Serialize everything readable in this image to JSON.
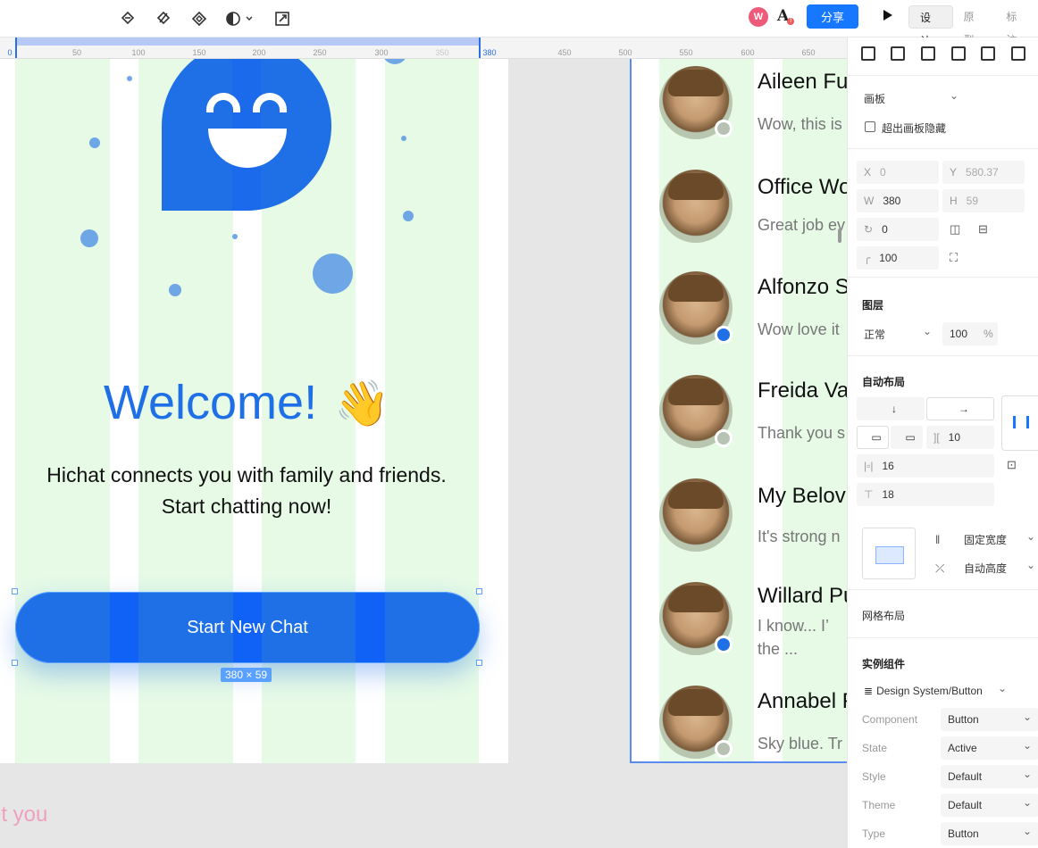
{
  "toolbar": {
    "icons": [
      "component-link-icon",
      "detach-icon",
      "instance-diamond-icon",
      "contrast-icon",
      "export-icon"
    ],
    "avatar_letter": "W",
    "share_label": "分享",
    "tabs": [
      "设计",
      "原型",
      "标注"
    ],
    "active_tab": "设计"
  },
  "ruler": {
    "ticks": [
      "0",
      "50",
      "100",
      "150",
      "200",
      "250",
      "300",
      "350",
      "380",
      "450",
      "500",
      "550",
      "600",
      "650"
    ]
  },
  "left_frame": {
    "welcome": "Welcome!",
    "wave_emoji": "👋",
    "subtitle_line1": "Hichat connects you with family and friends.",
    "subtitle_line2": "Start chatting now!",
    "button_label": "Start New Chat",
    "size_label": "380 × 59"
  },
  "ghost_text": {
    "line1": "et you",
    "line2": "t"
  },
  "chats": [
    {
      "name": "Aileen Fu",
      "message": "Wow, this is",
      "status": "offline"
    },
    {
      "name": "Office Wo",
      "message": "Great job ev",
      "status": "none"
    },
    {
      "name": "Alfonzo S",
      "message": "Wow love it",
      "status": "online"
    },
    {
      "name": "Freida Va",
      "message": "Thank you s",
      "status": "offline"
    },
    {
      "name": "My Belov",
      "message": "It's strong n",
      "status": "none"
    },
    {
      "name": "Willard Pu",
      "message": "I know... I’",
      "message2": "the ...",
      "status": "online"
    },
    {
      "name": "Annabel F",
      "message": "Sky blue. Tr",
      "status": "offline"
    }
  ],
  "panel": {
    "frame_type": "画板",
    "clip_label": "超出画板隐藏",
    "x_label": "X",
    "x_value": "0",
    "y_label": "Y",
    "y_value": "580.37",
    "w_label": "W",
    "w_value": "380",
    "h_label": "H",
    "h_value": "59",
    "rotation": "0",
    "radius": "100",
    "layer_title": "图层",
    "blend_mode": "正常",
    "opacity": "100",
    "opacity_unit": "%",
    "auto_layout_title": "自动布局",
    "gap": "10",
    "padding_h": "16",
    "padding_v": "18",
    "width_mode": "固定宽度",
    "height_mode": "自动高度",
    "grid_title": "网格布局",
    "instance_title": "实例组件",
    "instance_name": "Design System/Button",
    "props": [
      {
        "label": "Component",
        "value": "Button"
      },
      {
        "label": "State",
        "value": "Active"
      },
      {
        "label": "Style",
        "value": "Default"
      },
      {
        "label": "Theme",
        "value": "Default"
      },
      {
        "label": "Type",
        "value": "Button"
      }
    ]
  }
}
